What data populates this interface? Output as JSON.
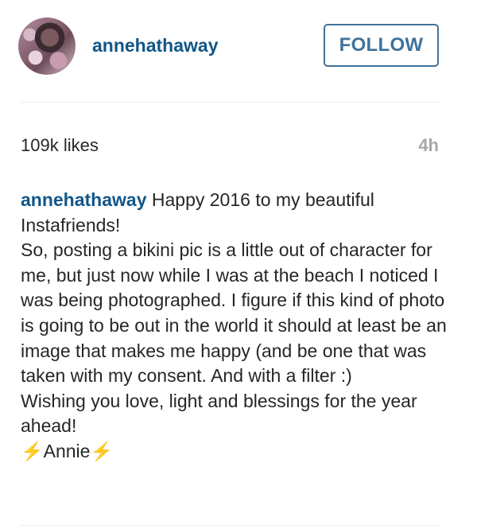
{
  "post": {
    "username": "annehathaway",
    "follow_label": "FOLLOW",
    "likes": "109k likes",
    "time": "4h",
    "caption_user": "annehathaway",
    "caption_text": "Happy 2016 to my beautiful Instafriends!\nSo, posting a bikini pic is a little out of character for me, but just now while I was at the beach I noticed I was being photographed. I figure if this kind of photo is going to be out in the world it should at least be an image that makes me happy (and be one that was taken with my consent. And with a filter :)\nWishing you love, light and blessings for the year ahead!\n⚡️Annie⚡️"
  },
  "colors": {
    "link": "#125688",
    "follow_border": "#3f729b",
    "muted": "#a5a7aa"
  }
}
